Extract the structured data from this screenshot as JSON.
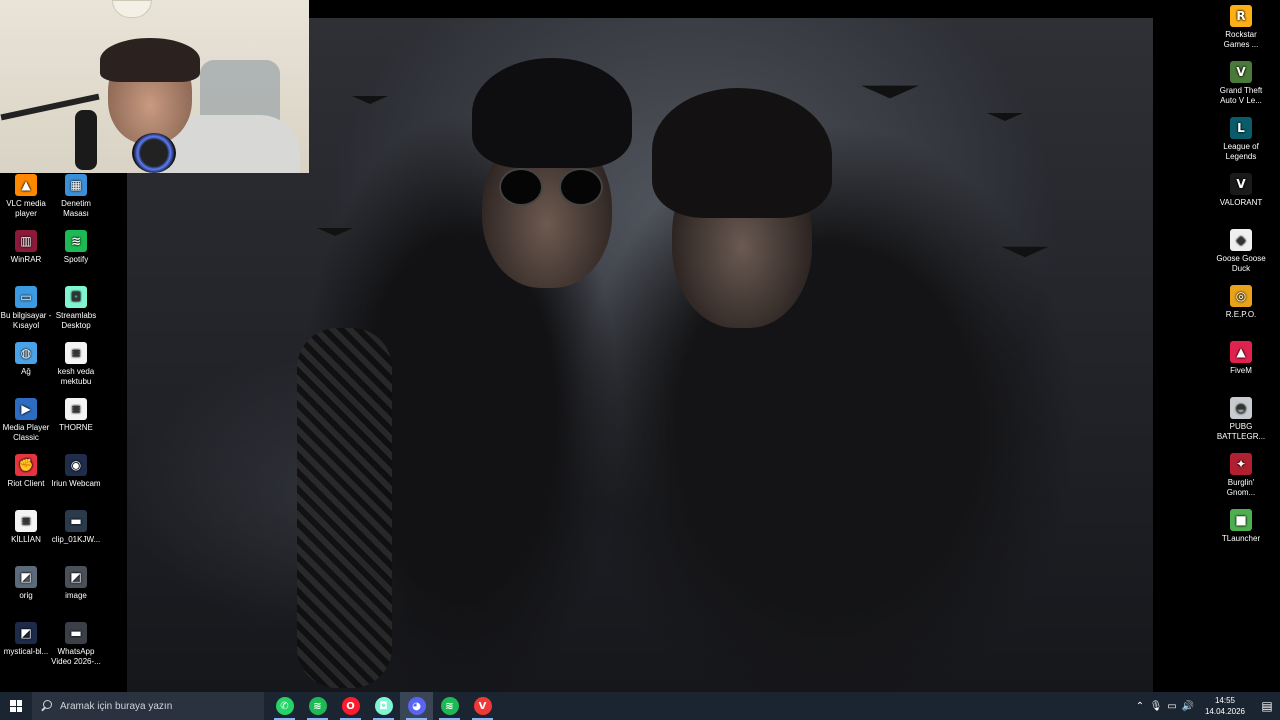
{
  "desktop": {
    "left_icons": [
      {
        "label": "VLC media player",
        "icon": "vlc-icon",
        "color": "#ff8800",
        "glyph": "▲"
      },
      {
        "label": "Denetim Masası",
        "icon": "control-panel-icon",
        "color": "#3a8fd6",
        "glyph": "▦"
      },
      {
        "label": "WinRAR",
        "icon": "winrar-icon",
        "color": "#8b1a3a",
        "glyph": "▥"
      },
      {
        "label": "Spotify",
        "icon": "spotify-icon",
        "color": "#1db954",
        "glyph": "≋"
      },
      {
        "label": "Bu bilgisayar - Kısayol",
        "icon": "this-pc-icon",
        "color": "#3b9ae1",
        "glyph": "▭"
      },
      {
        "label": "Streamlabs Desktop",
        "icon": "streamlabs-icon",
        "color": "#80f5d2",
        "glyph": "◘"
      },
      {
        "label": "Ağ",
        "icon": "network-icon",
        "color": "#4aa3e8",
        "glyph": "◍"
      },
      {
        "label": "kesh veda mektubu",
        "icon": "text-file-icon",
        "color": "#f4f4f4",
        "glyph": "≡"
      },
      {
        "label": "Media Player Classic",
        "icon": "media-player-classic-icon",
        "color": "#2d6cc0",
        "glyph": "▶"
      },
      {
        "label": "THORNE",
        "icon": "text-file-icon",
        "color": "#f4f4f4",
        "glyph": "≡"
      },
      {
        "label": "Riot Client",
        "icon": "riot-client-icon",
        "color": "#e8343f",
        "glyph": "✊"
      },
      {
        "label": "Iriun Webcam",
        "icon": "iriun-webcam-icon",
        "color": "#1f2c4a",
        "glyph": "◉"
      },
      {
        "label": "KİLLİAN",
        "icon": "text-file-icon",
        "color": "#f4f4f4",
        "glyph": "≡"
      },
      {
        "label": "clip_01KJW...",
        "icon": "video-file-icon",
        "color": "#2a3a4a",
        "glyph": "▬"
      },
      {
        "label": "orig",
        "icon": "image-file-icon",
        "color": "#5b6b7b",
        "glyph": "◩"
      },
      {
        "label": "image",
        "icon": "image-file-icon",
        "color": "#4a4f58",
        "glyph": "◩"
      },
      {
        "label": "mystical-bl...",
        "icon": "image-file-icon",
        "color": "#1e2a4a",
        "glyph": "◩"
      },
      {
        "label": "WhatsApp Video 2026-...",
        "icon": "video-file-icon",
        "color": "#3a3f48",
        "glyph": "▬"
      }
    ],
    "right_icons": [
      {
        "label": "Rockstar Games ...",
        "icon": "rockstar-icon",
        "color": "#fcaf17",
        "glyph": "R"
      },
      {
        "label": "Grand Theft Auto V Le...",
        "icon": "gta-v-icon",
        "color": "#4a7a3a",
        "glyph": "V"
      },
      {
        "label": "League of Legends",
        "icon": "league-of-legends-icon",
        "color": "#0a5c6b",
        "glyph": "L"
      },
      {
        "label": "VALORANT",
        "icon": "valorant-icon",
        "color": "#1a1a1a",
        "glyph": "V"
      },
      {
        "label": "Goose Goose Duck",
        "icon": "goose-goose-duck-icon",
        "color": "#f0f0f0",
        "glyph": "◆"
      },
      {
        "label": "R.E.P.O.",
        "icon": "repo-icon",
        "color": "#e8a31a",
        "glyph": "◎"
      },
      {
        "label": "FiveM",
        "icon": "fivem-icon",
        "color": "#e0234e",
        "glyph": "▲"
      },
      {
        "label": "PUBG BATTLEGR...",
        "icon": "pubg-icon",
        "color": "#c8ccd0",
        "glyph": "◓"
      },
      {
        "label": "Burglin' Gnom...",
        "icon": "burglin-gnomes-icon",
        "color": "#b02030",
        "glyph": "✦"
      },
      {
        "label": "TLauncher",
        "icon": "tlauncher-icon",
        "color": "#4caf50",
        "glyph": "■"
      }
    ]
  },
  "taskbar": {
    "search_placeholder": "Aramak için buraya yazın",
    "apps": [
      {
        "name": "whatsapp",
        "color": "#25d366",
        "glyph": "✆",
        "active": false
      },
      {
        "name": "spotify",
        "color": "#1db954",
        "glyph": "≋",
        "active": false
      },
      {
        "name": "opera",
        "color": "#ff1b2d",
        "glyph": "O",
        "active": false
      },
      {
        "name": "streamlabs",
        "color": "#80f5d2",
        "glyph": "◘",
        "active": false
      },
      {
        "name": "discord",
        "color": "#5865f2",
        "glyph": "◕",
        "active": true
      },
      {
        "name": "spotify-2",
        "color": "#1db954",
        "glyph": "≋",
        "active": false
      },
      {
        "name": "vivaldi",
        "color": "#ef3939",
        "glyph": "V",
        "active": false
      }
    ],
    "clock_time": "14:55",
    "clock_date": "14.04.2026"
  }
}
